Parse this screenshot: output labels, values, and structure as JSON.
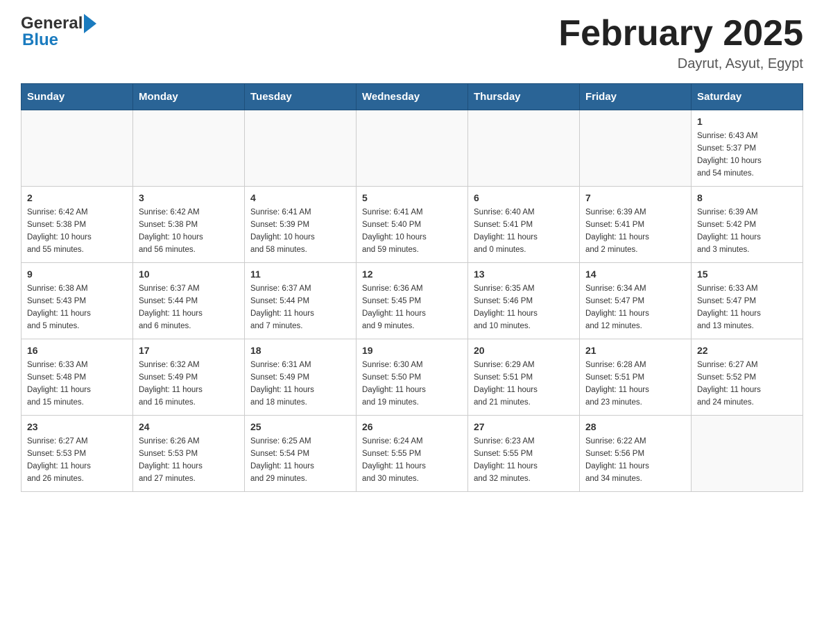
{
  "header": {
    "logo_general": "General",
    "logo_blue": "Blue",
    "title": "February 2025",
    "subtitle": "Dayrut, Asyut, Egypt"
  },
  "calendar": {
    "days_of_week": [
      "Sunday",
      "Monday",
      "Tuesday",
      "Wednesday",
      "Thursday",
      "Friday",
      "Saturday"
    ],
    "weeks": [
      [
        {
          "day": "",
          "info": ""
        },
        {
          "day": "",
          "info": ""
        },
        {
          "day": "",
          "info": ""
        },
        {
          "day": "",
          "info": ""
        },
        {
          "day": "",
          "info": ""
        },
        {
          "day": "",
          "info": ""
        },
        {
          "day": "1",
          "info": "Sunrise: 6:43 AM\nSunset: 5:37 PM\nDaylight: 10 hours\nand 54 minutes."
        }
      ],
      [
        {
          "day": "2",
          "info": "Sunrise: 6:42 AM\nSunset: 5:38 PM\nDaylight: 10 hours\nand 55 minutes."
        },
        {
          "day": "3",
          "info": "Sunrise: 6:42 AM\nSunset: 5:38 PM\nDaylight: 10 hours\nand 56 minutes."
        },
        {
          "day": "4",
          "info": "Sunrise: 6:41 AM\nSunset: 5:39 PM\nDaylight: 10 hours\nand 58 minutes."
        },
        {
          "day": "5",
          "info": "Sunrise: 6:41 AM\nSunset: 5:40 PM\nDaylight: 10 hours\nand 59 minutes."
        },
        {
          "day": "6",
          "info": "Sunrise: 6:40 AM\nSunset: 5:41 PM\nDaylight: 11 hours\nand 0 minutes."
        },
        {
          "day": "7",
          "info": "Sunrise: 6:39 AM\nSunset: 5:41 PM\nDaylight: 11 hours\nand 2 minutes."
        },
        {
          "day": "8",
          "info": "Sunrise: 6:39 AM\nSunset: 5:42 PM\nDaylight: 11 hours\nand 3 minutes."
        }
      ],
      [
        {
          "day": "9",
          "info": "Sunrise: 6:38 AM\nSunset: 5:43 PM\nDaylight: 11 hours\nand 5 minutes."
        },
        {
          "day": "10",
          "info": "Sunrise: 6:37 AM\nSunset: 5:44 PM\nDaylight: 11 hours\nand 6 minutes."
        },
        {
          "day": "11",
          "info": "Sunrise: 6:37 AM\nSunset: 5:44 PM\nDaylight: 11 hours\nand 7 minutes."
        },
        {
          "day": "12",
          "info": "Sunrise: 6:36 AM\nSunset: 5:45 PM\nDaylight: 11 hours\nand 9 minutes."
        },
        {
          "day": "13",
          "info": "Sunrise: 6:35 AM\nSunset: 5:46 PM\nDaylight: 11 hours\nand 10 minutes."
        },
        {
          "day": "14",
          "info": "Sunrise: 6:34 AM\nSunset: 5:47 PM\nDaylight: 11 hours\nand 12 minutes."
        },
        {
          "day": "15",
          "info": "Sunrise: 6:33 AM\nSunset: 5:47 PM\nDaylight: 11 hours\nand 13 minutes."
        }
      ],
      [
        {
          "day": "16",
          "info": "Sunrise: 6:33 AM\nSunset: 5:48 PM\nDaylight: 11 hours\nand 15 minutes."
        },
        {
          "day": "17",
          "info": "Sunrise: 6:32 AM\nSunset: 5:49 PM\nDaylight: 11 hours\nand 16 minutes."
        },
        {
          "day": "18",
          "info": "Sunrise: 6:31 AM\nSunset: 5:49 PM\nDaylight: 11 hours\nand 18 minutes."
        },
        {
          "day": "19",
          "info": "Sunrise: 6:30 AM\nSunset: 5:50 PM\nDaylight: 11 hours\nand 19 minutes."
        },
        {
          "day": "20",
          "info": "Sunrise: 6:29 AM\nSunset: 5:51 PM\nDaylight: 11 hours\nand 21 minutes."
        },
        {
          "day": "21",
          "info": "Sunrise: 6:28 AM\nSunset: 5:51 PM\nDaylight: 11 hours\nand 23 minutes."
        },
        {
          "day": "22",
          "info": "Sunrise: 6:27 AM\nSunset: 5:52 PM\nDaylight: 11 hours\nand 24 minutes."
        }
      ],
      [
        {
          "day": "23",
          "info": "Sunrise: 6:27 AM\nSunset: 5:53 PM\nDaylight: 11 hours\nand 26 minutes."
        },
        {
          "day": "24",
          "info": "Sunrise: 6:26 AM\nSunset: 5:53 PM\nDaylight: 11 hours\nand 27 minutes."
        },
        {
          "day": "25",
          "info": "Sunrise: 6:25 AM\nSunset: 5:54 PM\nDaylight: 11 hours\nand 29 minutes."
        },
        {
          "day": "26",
          "info": "Sunrise: 6:24 AM\nSunset: 5:55 PM\nDaylight: 11 hours\nand 30 minutes."
        },
        {
          "day": "27",
          "info": "Sunrise: 6:23 AM\nSunset: 5:55 PM\nDaylight: 11 hours\nand 32 minutes."
        },
        {
          "day": "28",
          "info": "Sunrise: 6:22 AM\nSunset: 5:56 PM\nDaylight: 11 hours\nand 34 minutes."
        },
        {
          "day": "",
          "info": ""
        }
      ]
    ]
  }
}
